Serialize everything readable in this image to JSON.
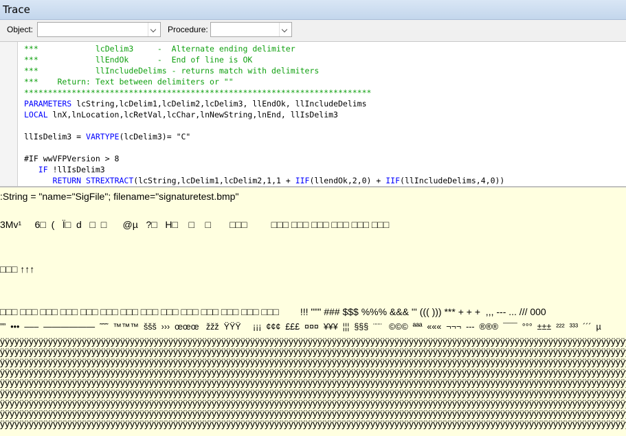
{
  "window": {
    "title": "Trace"
  },
  "toolbar": {
    "object_label": "Object:",
    "object_value": "",
    "procedure_label": "Procedure:",
    "procedure_value": ""
  },
  "code": {
    "lines": [
      [
        {
          "t": "***            lcDelim3     -  Alternate ending delimiter",
          "c": "cm"
        }
      ],
      [
        {
          "t": "***            llEndOk      -  End of line is OK",
          "c": "cm"
        }
      ],
      [
        {
          "t": "***            llIncludeDelims - returns match with delimiters",
          "c": "cm"
        }
      ],
      [
        {
          "t": "***    Return: Text between delimiters or \"\"",
          "c": "cm"
        }
      ],
      [
        {
          "t": "*************************************************************************",
          "c": "cm"
        }
      ],
      [
        {
          "t": "PARAMETERS",
          "c": "kw"
        },
        {
          "t": " lcString,lcDelim1,lcDelim2,lcDelim3, llEndOk, llIncludeDelims",
          "c": "tx"
        }
      ],
      [
        {
          "t": "LOCAL",
          "c": "kw"
        },
        {
          "t": " lnX,lnLocation,lcRetVal,lcChar,lnNewString,lnEnd, llIsDelim3",
          "c": "tx"
        }
      ],
      [
        {
          "t": "",
          "c": "tx"
        }
      ],
      [
        {
          "t": "llIsDelim3 = ",
          "c": "tx"
        },
        {
          "t": "VARTYPE",
          "c": "kw"
        },
        {
          "t": "(lcDelim3)= \"C\"",
          "c": "tx"
        }
      ],
      [
        {
          "t": "",
          "c": "tx"
        }
      ],
      [
        {
          "t": "#IF wwVFPVersion > 8",
          "c": "tx"
        }
      ],
      [
        {
          "t": "   ",
          "c": "tx"
        },
        {
          "t": "IF",
          "c": "kw"
        },
        {
          "t": " !llIsDelim3",
          "c": "tx"
        }
      ],
      [
        {
          "t": "      ",
          "c": "tx"
        },
        {
          "t": "RETURN",
          "c": "kw"
        },
        {
          "t": " ",
          "c": "tx"
        },
        {
          "t": "STREXTRACT",
          "c": "kw"
        },
        {
          "t": "(lcString,lcDelim1,lcDelim2,1,1 + ",
          "c": "tx"
        },
        {
          "t": "IIF",
          "c": "kw"
        },
        {
          "t": "(llendOk,2,0) + ",
          "c": "tx"
        },
        {
          "t": "IIF",
          "c": "kw"
        },
        {
          "t": "(llIncludeDelims,4,0))",
          "c": "tx"
        }
      ]
    ]
  },
  "output": {
    "line1": ":String = \"name=\"SigFile\"; filename=\"signaturetest.bmp\"",
    "line2": "3Mv¹     6□  (   Ï□  d   □  □      @µ   ?□   H□    □    □       □□□         □□□ □□□ □□□ □□□ □□□ □□□",
    "line3": "□□□ ↑↑↑",
    "line4": "□□□ □□□ □□□ □□□ □□□ □□□ □□□ □□□ □□□ □□□ □□□ □□□ □□□ □□□        !!! \"\"\" ### $$$ %%% &&& ''' ((( ))) *** + + +  ,,, --- ... /// 000",
    "line5": "””  •••  –––  ——————  ˜˜˜  ™™™  ššš  ›››  œœœ   žžž  ŸŸŸ     ¡¡¡  ¢¢¢  £££  ¤¤¤  ¥¥¥  ¦¦¦  §§§  ¨¨¨   ©©©  ªªª  «««  ¬¬¬  ---  ®®®  ¯¯¯  °°°  ±±±  ²²²  ³³³  ´´´  µ",
    "yline": "ÿÿÿÿÿÿÿÿÿÿÿÿÿÿÿÿÿÿÿÿÿÿÿÿÿÿÿÿÿÿÿÿÿÿÿÿÿÿÿÿÿÿÿÿÿÿÿÿÿÿÿÿÿÿÿÿÿÿÿÿÿÿÿÿÿÿÿÿÿÿÿÿÿÿÿÿÿÿÿÿÿÿÿÿÿÿÿÿÿÿÿÿÿÿÿÿÿÿÿÿÿÿÿÿÿÿÿÿÿÿÿÿÿÿÿÿÿÿÿÿÿÿÿÿÿÿÿÿÿÿÿÿÿÿÿÿÿÿÿÿÿÿÿÿÿÿÿÿÿÿ",
    "yline_count": 9
  }
}
